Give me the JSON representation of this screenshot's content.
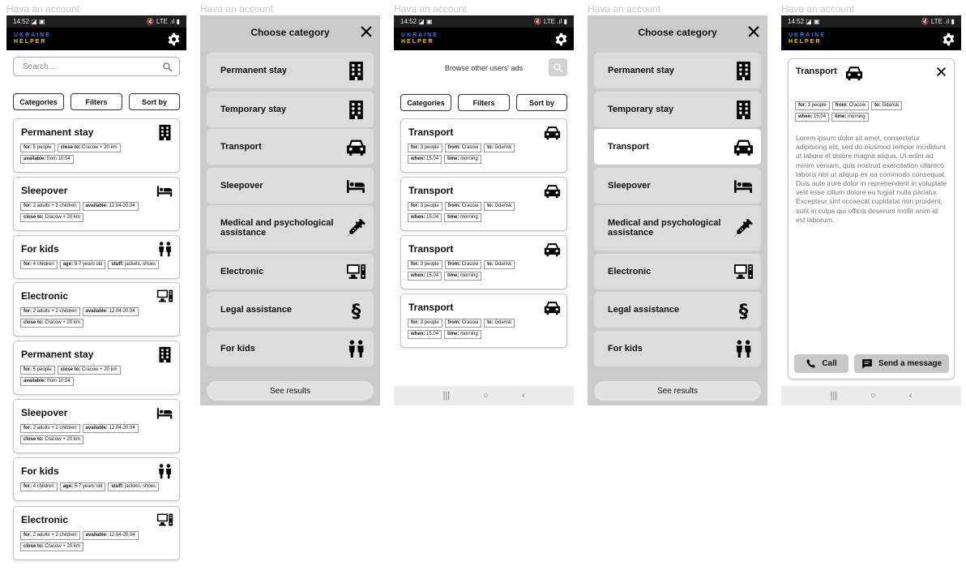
{
  "frame_title": "Hava an account",
  "status": {
    "time": "14:52",
    "icons": "◪ ▣",
    "right": "🔇 LTE .ıl ▮"
  },
  "app": {
    "name_line1": "UKRAINE",
    "name_line2": "HELPER",
    "brand_blue": "#3a78d8",
    "brand_yellow": "#f2c214"
  },
  "search": {
    "placeholder": "Search..."
  },
  "browse": {
    "label": "Browse other users' ads"
  },
  "buttons": {
    "categories": "Categories",
    "filters": "Filters",
    "sort": "Sort by"
  },
  "list_cards": [
    {
      "title": "Permanent stay",
      "icon": "building-icon",
      "tags": [
        [
          "for:",
          "5 people"
        ],
        [
          "close to:",
          "Cracow + 20 km"
        ],
        [
          "available:",
          "from 10.04"
        ]
      ]
    },
    {
      "title": "Sleepover",
      "icon": "bed-icon",
      "tags": [
        [
          "for:",
          "2 adults + 2 children"
        ],
        [
          "available:",
          "12.04-20.04"
        ],
        [
          "close to:",
          "Cracow + 20 km"
        ]
      ]
    },
    {
      "title": "For kids",
      "icon": "kids-icon",
      "tags": [
        [
          "for:",
          "4 children"
        ],
        [
          "age:",
          "5-7 years old"
        ],
        [
          "stuff:",
          "jackets, shoes"
        ]
      ]
    },
    {
      "title": "Electronic",
      "icon": "computer-icon",
      "tags": [
        [
          "for:",
          "2 adults + 2 children"
        ],
        [
          "available:",
          "12.04-20.04"
        ],
        [
          "close to:",
          "Cracow + 20 km"
        ]
      ]
    },
    {
      "title": "Permanent stay",
      "icon": "building-icon",
      "tags": [
        [
          "for:",
          "5 people"
        ],
        [
          "close to:",
          "Cracow + 20 km"
        ],
        [
          "available:",
          "from 10.04"
        ]
      ]
    },
    {
      "title": "Sleepover",
      "icon": "bed-icon",
      "tags": [
        [
          "for:",
          "2 adults + 2 children"
        ],
        [
          "available:",
          "12.04-20.04"
        ],
        [
          "close to:",
          "Cracow + 20 km"
        ]
      ]
    },
    {
      "title": "For kids",
      "icon": "kids-icon",
      "tags": [
        [
          "for:",
          "4 children"
        ],
        [
          "age:",
          "5-7 years old"
        ],
        [
          "stuff:",
          "jackets, shoes"
        ]
      ]
    },
    {
      "title": "Electronic",
      "icon": "computer-icon",
      "tags": [
        [
          "for:",
          "2 adults + 2 children"
        ],
        [
          "available:",
          "12.04-20.04"
        ],
        [
          "close to:",
          "Cracow + 20 km"
        ]
      ]
    }
  ],
  "transport_cards": [
    {
      "title": "Transport",
      "icon": "car-icon",
      "tags": [
        [
          "for:",
          "3 people"
        ],
        [
          "from:",
          "Cracow"
        ],
        [
          "to:",
          "Gdańsk"
        ],
        [
          "when:",
          "15.04"
        ],
        [
          "time:",
          "morning"
        ]
      ]
    },
    {
      "title": "Transport",
      "icon": "car-icon",
      "tags": [
        [
          "for:",
          "3 people"
        ],
        [
          "from:",
          "Cracow"
        ],
        [
          "to:",
          "Gdańsk"
        ],
        [
          "when:",
          "15.04"
        ],
        [
          "time:",
          "morning"
        ]
      ]
    },
    {
      "title": "Transport",
      "icon": "car-icon",
      "tags": [
        [
          "for:",
          "3 people"
        ],
        [
          "from:",
          "Cracow"
        ],
        [
          "to:",
          "Gdańsk"
        ],
        [
          "when:",
          "15.04"
        ],
        [
          "time:",
          "morning"
        ]
      ]
    },
    {
      "title": "Transport",
      "icon": "car-icon",
      "tags": [
        [
          "for:",
          "3 people"
        ],
        [
          "from:",
          "Cracow"
        ],
        [
          "to:",
          "Gdańsk"
        ],
        [
          "when:",
          "15.04"
        ],
        [
          "time:",
          "morning"
        ]
      ]
    }
  ],
  "category_dialog": {
    "title": "Choose category",
    "see_results": "See results",
    "categories": [
      {
        "label": "Permanent stay",
        "icon": "building-icon"
      },
      {
        "label": "Temporary stay",
        "icon": "building-icon"
      },
      {
        "label": "Transport",
        "icon": "car-icon"
      },
      {
        "label": "Sleepover",
        "icon": "bed-icon"
      },
      {
        "label": "Medical and psychological assistance",
        "icon": "syringe-icon"
      },
      {
        "label": "Electronic",
        "icon": "computer-icon"
      },
      {
        "label": "Legal assistance",
        "icon": "paragraph-icon"
      },
      {
        "label": "For kids",
        "icon": "kids-icon"
      }
    ]
  },
  "nav": {
    "recent": "|||",
    "home": "○",
    "back": "‹"
  },
  "detail": {
    "title": "Transport",
    "icon": "car-icon",
    "tags": [
      [
        "for:",
        "3 people"
      ],
      [
        "from:",
        "Cracow"
      ],
      [
        "to:",
        "Gdańsk"
      ],
      [
        "when:",
        "15.04"
      ],
      [
        "time:",
        "morning"
      ]
    ],
    "description": "Lorem ipsum dolor sit amet, consectetur adipiscing elit, sed do eiusmod tempor incididunt ut labore et dolore magna aliqua. Ut enim ad minim veniam, quis nostrud exercitation ullamco laboris nisi ut aliquip ex ea commodo consequat. Duis aute irure dolor in reprehenderit in voluptate velit esse cillum dolore eu fugiat nulla pariatur. Excepteur sint occaecat cupidatat non proident, sunt in culpa qui officia deserunt mollit anim id est laborum.",
    "call": "Call",
    "message": "Send a message"
  }
}
